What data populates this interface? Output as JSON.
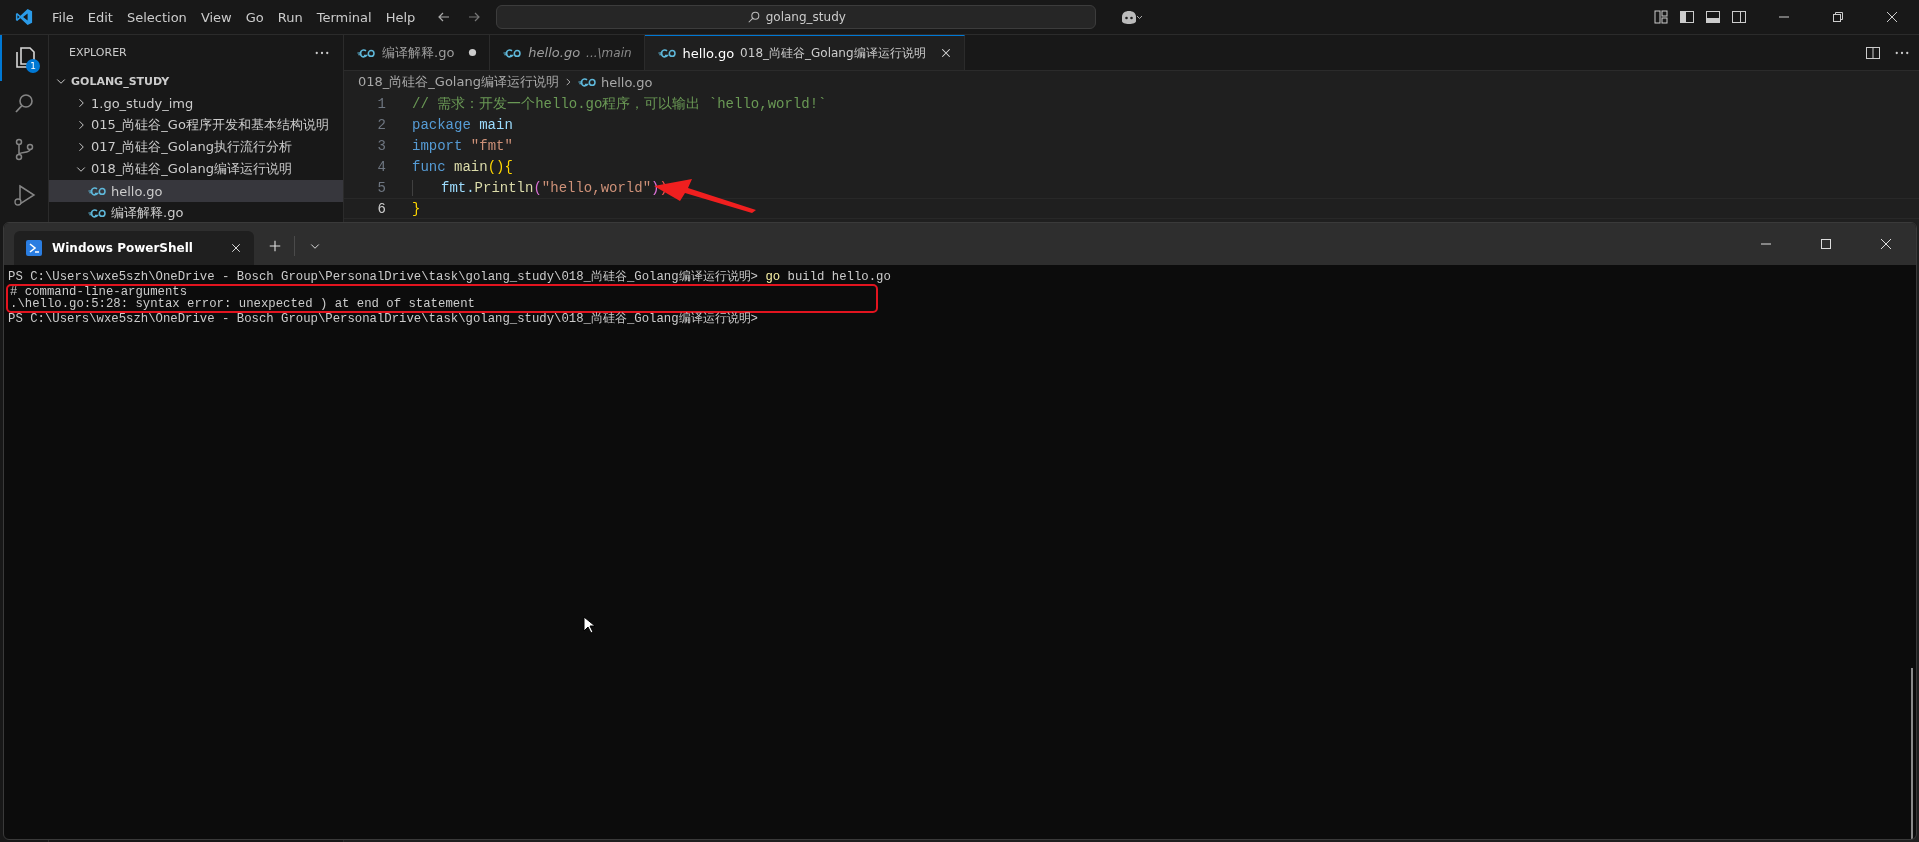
{
  "title_bar": {
    "menu": [
      "File",
      "Edit",
      "Selection",
      "View",
      "Go",
      "Run",
      "Terminal",
      "Help"
    ],
    "search": "golang_study"
  },
  "activity_bar": [
    {
      "kind": "explorer",
      "selected": true,
      "badge": "1"
    },
    {
      "kind": "search",
      "selected": false
    },
    {
      "kind": "source-control",
      "selected": false
    },
    {
      "kind": "debug",
      "selected": false
    }
  ],
  "sidebar": {
    "title": "EXPLORER",
    "root": "GOLANG_STUDY",
    "items": [
      {
        "label": "1.go_study_img",
        "expanded": false
      },
      {
        "label": "015_尚硅谷_Go程序开发和基本结构说明",
        "expanded": false
      },
      {
        "label": "017_尚硅谷_Golang执行流行分析",
        "expanded": false
      },
      {
        "label": "018_尚硅谷_Golang编译运行说明",
        "expanded": true,
        "children": [
          {
            "label": "hello.go",
            "selected": true
          },
          {
            "label": "编译解释.go",
            "selected": false
          }
        ]
      }
    ]
  },
  "editor": {
    "tabs": [
      {
        "label": "编译解释.go",
        "modified": true,
        "preview": false,
        "selected": false
      },
      {
        "label": "hello.go",
        "description": "...\\main",
        "modified": false,
        "preview": true,
        "selected": false
      },
      {
        "label": "hello.go",
        "description": "018_尚硅谷_Golang编译运行说明",
        "modified": false,
        "preview": false,
        "selected": true
      }
    ],
    "breadcrumb": [
      "018_尚硅谷_Golang编译运行说明",
      "hello.go"
    ],
    "lines": [
      {
        "number": "1",
        "current": false,
        "tokens": [
          {
            "kind": "comment",
            "text": "// 需求：开发一个hello.go程序，可以输出 `hello,world!`"
          }
        ]
      },
      {
        "number": "2",
        "current": false,
        "tokens": [
          {
            "kind": "keyword",
            "text": "package"
          },
          {
            "kind": "plain",
            "text": " main"
          }
        ]
      },
      {
        "number": "3",
        "current": false,
        "tokens": [
          {
            "kind": "keyword",
            "text": "import"
          },
          {
            "kind": "string",
            "text": " \"fmt\""
          }
        ]
      },
      {
        "number": "4",
        "current": false,
        "tokens": [
          {
            "kind": "keyword",
            "text": "func"
          },
          {
            "kind": "func",
            "text": " main"
          },
          {
            "kind": "bracket",
            "text": "(){"
          }
        ]
      },
      {
        "number": "5",
        "current": false,
        "indent": true,
        "tokens": [
          {
            "kind": "plain",
            "text": "fmt."
          },
          {
            "kind": "func",
            "text": "Println"
          },
          {
            "kind": "bracket2",
            "text": "("
          },
          {
            "kind": "string",
            "text": "\"hello,world\""
          },
          {
            "kind": "bracket2",
            "text": ")"
          },
          {
            "kind": "error",
            "text": ")"
          }
        ]
      },
      {
        "number": "6",
        "current": true,
        "tokens": [
          {
            "kind": "bracket",
            "text": "}"
          }
        ]
      }
    ]
  },
  "terminal": {
    "tabs": [
      {
        "label": "Windows PowerShell",
        "selected": true
      }
    ],
    "lines": [
      {
        "highlighted": false,
        "segments": [
          {
            "kind": "plain",
            "text": "PS C:\\Users\\wxe5szh\\OneDrive - Bosch Group\\PersonalDrive\\task\\golang_study\\018_尚硅谷_Golang编译运行说明> "
          },
          {
            "kind": "command",
            "text": "go"
          },
          {
            "kind": "plain",
            "text": " build hello.go"
          }
        ]
      },
      {
        "highlighted": true,
        "segments": [
          {
            "kind": "plain",
            "text": "# command-line-arguments"
          }
        ]
      },
      {
        "highlighted": true,
        "segments": [
          {
            "kind": "plain",
            "text": ".\\hello.go:5:28: syntax error: unexpected ) at end of statement"
          }
        ]
      },
      {
        "highlighted": false,
        "segments": [
          {
            "kind": "plain",
            "text": "PS C:\\Users\\wxe5szh\\OneDrive - Bosch Group\\PersonalDrive\\task\\golang_study\\018_尚硅谷_Golang编译运行说明>"
          }
        ]
      }
    ]
  }
}
